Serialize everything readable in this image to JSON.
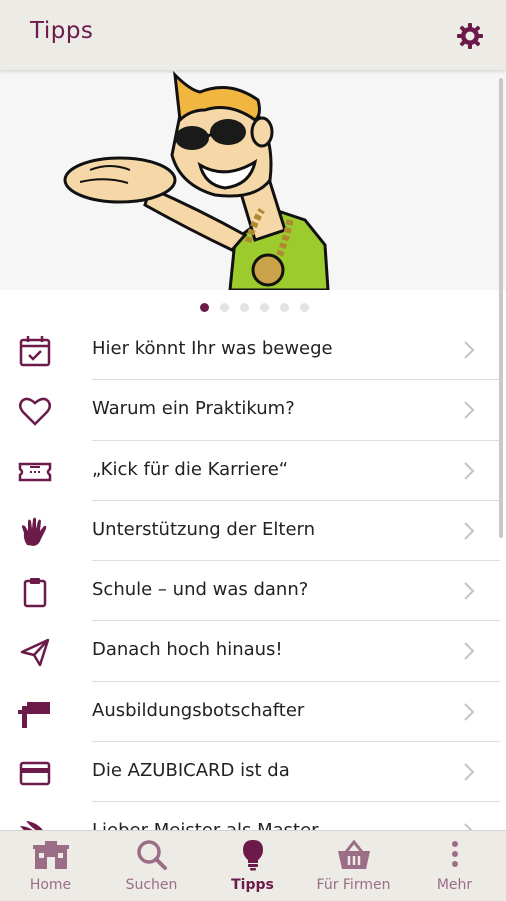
{
  "header": {
    "title": "Tipps",
    "settings_icon": "gear-icon"
  },
  "carousel": {
    "dots": 6,
    "active_index": 0
  },
  "list": {
    "items": [
      {
        "label": "Hier könnt Ihr was bewege",
        "icon": "calendar-check-icon"
      },
      {
        "label": "Warum ein Praktikum?",
        "icon": "heart-icon"
      },
      {
        "label": "„Kick für die Karriere“",
        "icon": "ticket-icon"
      },
      {
        "label": "Unterstützung der Eltern",
        "icon": "hand-icon"
      },
      {
        "label": "Schule – und was dann?",
        "icon": "clipboard-icon"
      },
      {
        "label": "Danach hoch hinaus!",
        "icon": "paper-plane-icon"
      },
      {
        "label": "Ausbildungsbotschafter",
        "icon": "flag-icon"
      },
      {
        "label": "Die AZUBICARD ist da",
        "icon": "credit-card-icon"
      },
      {
        "label": "Lieber Meister als Master",
        "icon": "wings-icon"
      }
    ]
  },
  "tabs": [
    {
      "label": "Home",
      "icon": "home-icon",
      "active": false
    },
    {
      "label": "Suchen",
      "icon": "search-icon",
      "active": false
    },
    {
      "label": "Tipps",
      "icon": "lightbulb-icon",
      "active": true
    },
    {
      "label": "Für Firmen",
      "icon": "basket-icon",
      "active": false
    },
    {
      "label": "Mehr",
      "icon": "more-vertical-icon",
      "active": false
    }
  ],
  "colors": {
    "accent": "#6b1a4a",
    "tab_inactive": "#9b6d87",
    "bar_bg": "#ecebe6"
  }
}
